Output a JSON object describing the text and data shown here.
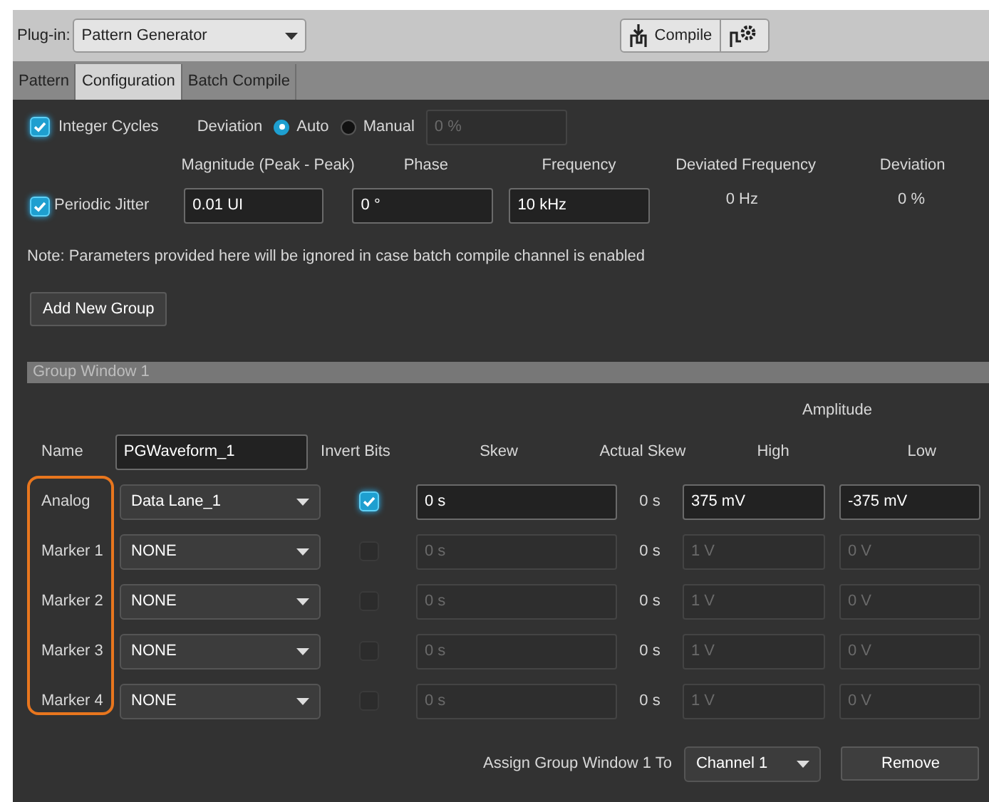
{
  "plugin": {
    "label": "Plug-in:",
    "value": "Pattern Generator"
  },
  "compile_button": {
    "label": "Compile"
  },
  "tabs": [
    {
      "label": "Pattern",
      "selected": false
    },
    {
      "label": "Configuration",
      "selected": true
    },
    {
      "label": "Batch Compile",
      "selected": false
    }
  ],
  "integer_cycles": {
    "label": "Integer Cycles",
    "checked": true
  },
  "deviation": {
    "label": "Deviation",
    "options": [
      {
        "label": "Auto",
        "selected": true
      },
      {
        "label": "Manual",
        "selected": false
      }
    ],
    "value": "0 %"
  },
  "jitter": {
    "label": "Periodic Jitter",
    "checked": true,
    "columns": [
      "Magnitude (Peak - Peak)",
      "Phase",
      "Frequency",
      "Deviated Frequency",
      "Deviation"
    ],
    "magnitude": "0.01 UI",
    "phase": "0 °",
    "frequency": "10 kHz",
    "deviated_frequency": "0 Hz",
    "deviation": "0 %"
  },
  "note": "Note: Parameters provided here will be ignored in case batch compile channel is enabled",
  "add_group_button": "Add New Group",
  "group": {
    "title": "Group Window 1",
    "name_label": "Name",
    "name": "PGWaveform_1",
    "amplitude_label": "Amplitude",
    "columns": [
      "Invert Bits",
      "Skew",
      "Actual Skew",
      "High",
      "Low"
    ],
    "rows": [
      {
        "label": "Analog",
        "source": "Data Lane_1",
        "invert": true,
        "disabled": false,
        "skew": "0 s",
        "actual_skew": "0 s",
        "high": "375 mV",
        "low": "-375 mV"
      },
      {
        "label": "Marker 1",
        "source": "NONE",
        "invert": false,
        "disabled": true,
        "skew": "0 s",
        "actual_skew": "0 s",
        "high": "1 V",
        "low": "0 V"
      },
      {
        "label": "Marker 2",
        "source": "NONE",
        "invert": false,
        "disabled": true,
        "skew": "0 s",
        "actual_skew": "0 s",
        "high": "1 V",
        "low": "0 V"
      },
      {
        "label": "Marker 3",
        "source": "NONE",
        "invert": false,
        "disabled": true,
        "skew": "0 s",
        "actual_skew": "0 s",
        "high": "1 V",
        "low": "0 V"
      },
      {
        "label": "Marker 4",
        "source": "NONE",
        "invert": false,
        "disabled": true,
        "skew": "0 s",
        "actual_skew": "0 s",
        "high": "1 V",
        "low": "0 V"
      }
    ],
    "assign_label": "Assign Group Window 1 To",
    "assign_value": "Channel 1",
    "remove_button": "Remove"
  }
}
